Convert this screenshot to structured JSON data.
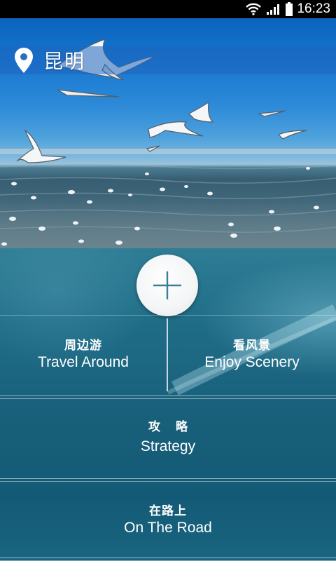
{
  "status_bar": {
    "time": "16:23",
    "icons": [
      "wifi-icon",
      "signal-icon",
      "battery-icon"
    ]
  },
  "location": {
    "icon": "location-pin-icon",
    "city": "昆明"
  },
  "actions": {
    "add_icon": "plus-icon"
  },
  "menu": {
    "travel_around": {
      "zh": "周边游",
      "en": "Travel Around"
    },
    "enjoy_scenery": {
      "zh": "看风景",
      "en": "Enjoy Scenery"
    },
    "strategy": {
      "zh": "攻 略",
      "en": "Strategy"
    },
    "on_the_road": {
      "zh": "在路上",
      "en": "On The Road"
    }
  },
  "colors": {
    "status_bar": "#000000",
    "location_bar": "#1e64be",
    "panel": "#185f7a",
    "add_icon_stroke": "#3a7f99",
    "text": "#ffffff"
  }
}
